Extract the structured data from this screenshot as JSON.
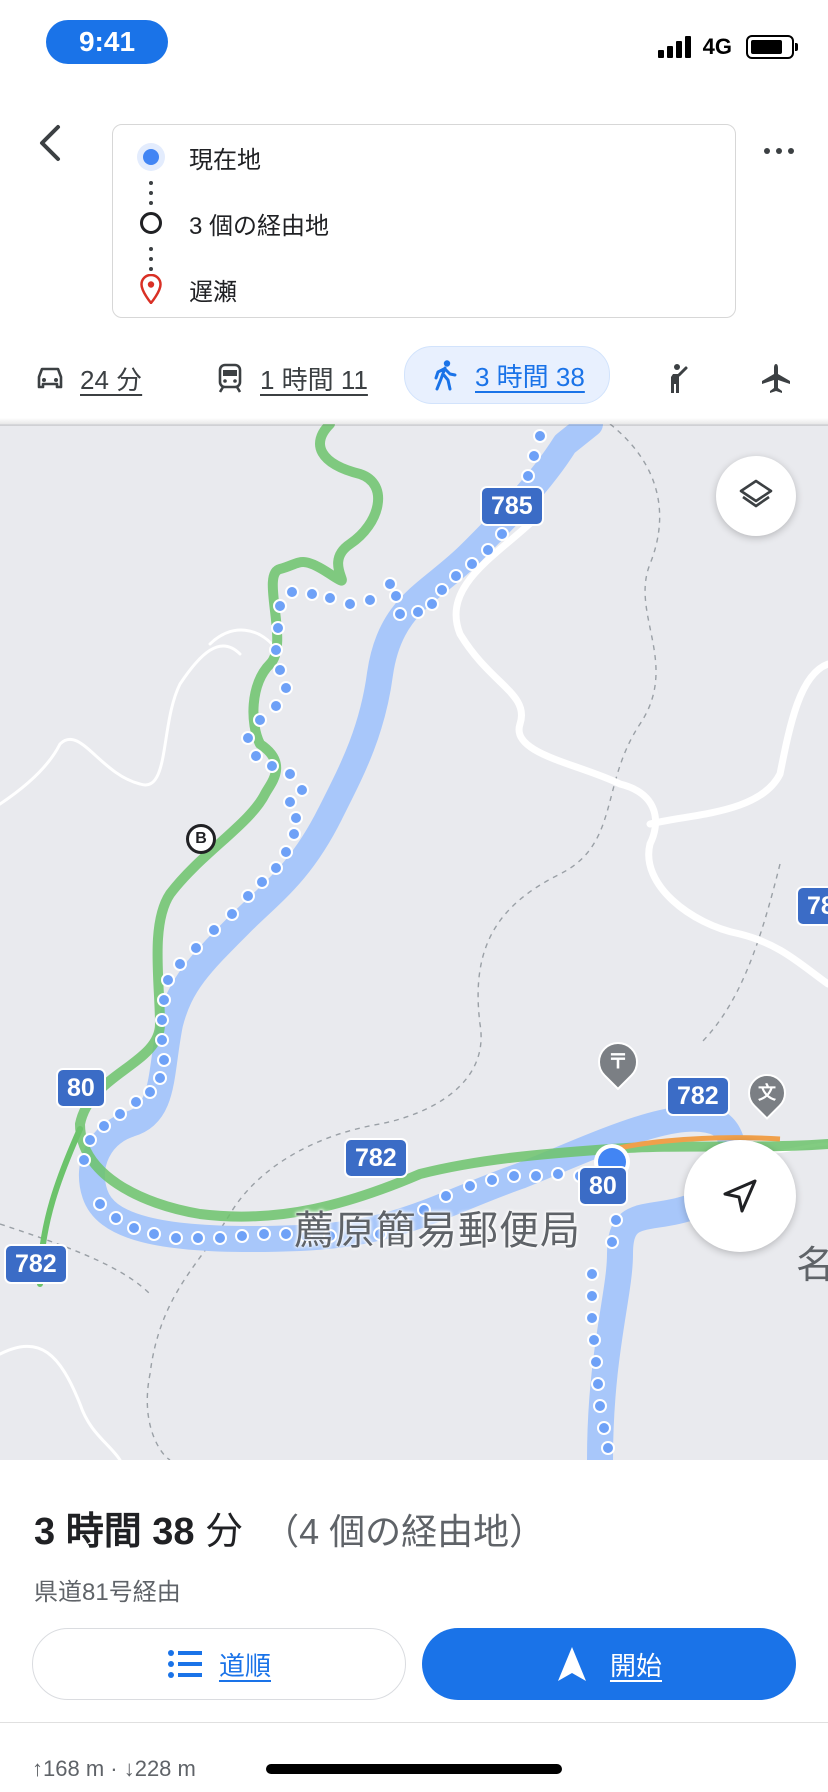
{
  "status_bar": {
    "time": "9:41",
    "network": "4G",
    "battery_level": 0.82
  },
  "route": {
    "origin": "現在地",
    "waypoints": "3 個の経由地",
    "destination": "遅瀬"
  },
  "modes": [
    {
      "name": "drive",
      "icon": "car-icon",
      "label": "24 分"
    },
    {
      "name": "transit",
      "icon": "train-icon",
      "label": "1 時間 11"
    },
    {
      "name": "walk",
      "icon": "walk-icon",
      "label": "3 時間 38",
      "active": true
    },
    {
      "name": "ride",
      "icon": "ride-hail-icon",
      "label": ""
    },
    {
      "name": "flight",
      "icon": "airplane-icon",
      "label": ""
    }
  ],
  "map": {
    "road_labels": [
      "785",
      "80",
      "782",
      "80",
      "782",
      "782",
      "78"
    ],
    "poi": "薦原簡易郵便局",
    "poi_partial": "名",
    "waypoint_marker": "B",
    "colors": {
      "route": "#4285f4",
      "river": "#a8c7fa",
      "road": "#ffffff",
      "route_outline": "#6cc36b"
    }
  },
  "summary": {
    "duration_prefix": "3 時間 ",
    "duration_value": "38",
    "duration_suffix": " 分",
    "stops": "（4 個の経由地）",
    "via": "県道81号経由",
    "steps_label": "道順",
    "start_label": "開始",
    "elevation": "168 m · ",
    "elevation_down": "228 m"
  }
}
